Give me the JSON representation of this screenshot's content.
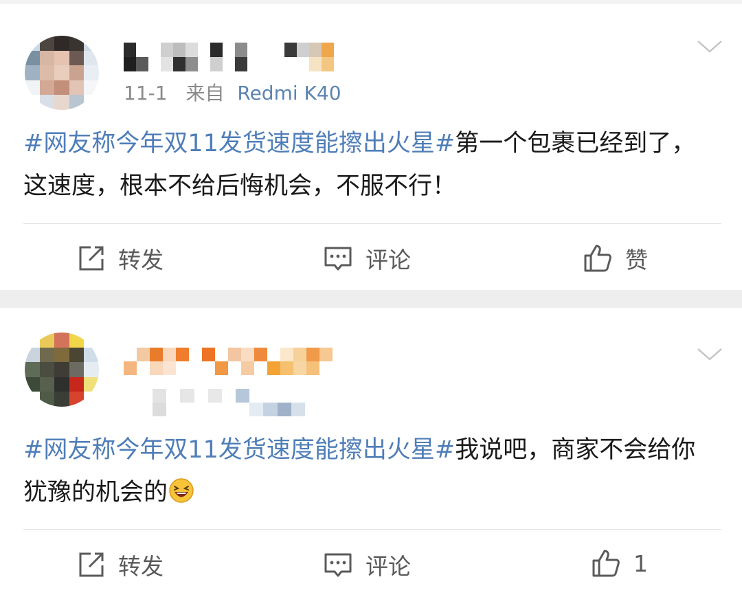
{
  "posts": [
    {
      "meta_time": "11-1",
      "meta_source_prefix": "来自",
      "meta_device": "Redmi K40",
      "topic": "#网友称今年双11发货速度能擦出火星#",
      "body": "第一个包裹已经到了，这速度，根本不给后悔机会，不服不行！",
      "actions": {
        "repost": "转发",
        "comment": "评论",
        "like": "赞"
      }
    },
    {
      "topic": "#网友称今年双11发货速度能擦出火星#",
      "body": "我说吧，商家不会给你犹豫的机会的",
      "emoji": "laughing-emoji",
      "actions": {
        "repost": "转发",
        "comment": "评论",
        "like": "1"
      }
    }
  ],
  "icons": {
    "repost": "repost-icon",
    "comment": "comment-icon",
    "like": "thumbs-up-icon",
    "menu": "chevron-down-icon"
  },
  "colors": {
    "topic": "#4f7eb8",
    "device": "#5b84b1",
    "text": "#1a1a1a",
    "action": "#5a5a5a",
    "background": "#eeeeee"
  }
}
